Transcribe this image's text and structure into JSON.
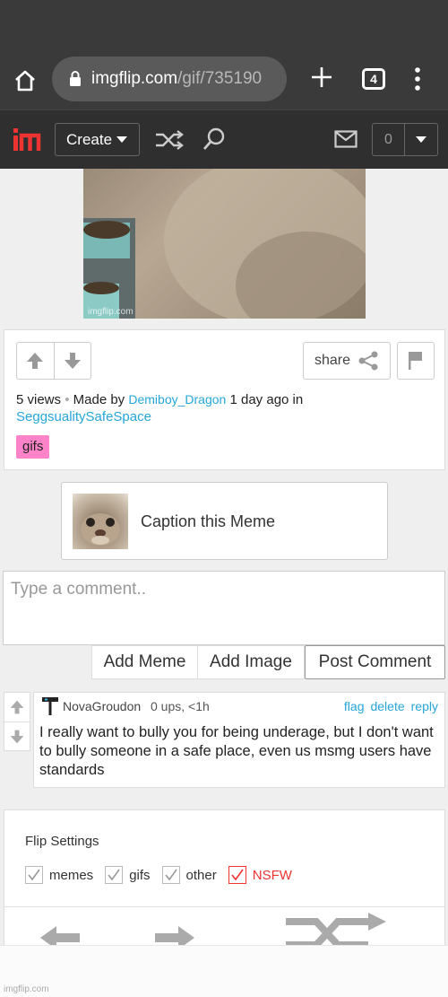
{
  "browser": {
    "url_domain": "imgflip.com",
    "url_path": "/gif/735190",
    "tab_count": "4"
  },
  "header": {
    "create_label": "Create",
    "notification_count": "0"
  },
  "gif": {
    "watermark": "imgflip.com"
  },
  "post": {
    "share_label": "share",
    "views": "5 views",
    "separator": "•",
    "made_by": "Made by",
    "creator": "Demiboy_Dragon",
    "time_text": "1 day ago in",
    "stream": "SeggsualitySafeSpace",
    "tag": "gifs"
  },
  "caption": {
    "label": "Caption this Meme"
  },
  "comment_box": {
    "placeholder": "Type a comment..",
    "add_meme": "Add Meme",
    "add_image": "Add Image",
    "post_comment": "Post Comment"
  },
  "comment": {
    "username": "NovaGroudon",
    "ups": "0 ups, <1h",
    "flag": "flag",
    "delete": "delete",
    "reply": "reply",
    "body": "I really want to bully you for being underage, but I don't want to bully someone in a safe place, even us msmg users have standards"
  },
  "flip_settings": {
    "title": "Flip Settings",
    "options": [
      "memes",
      "gifs",
      "other",
      "NSFW"
    ]
  },
  "bottom": {
    "brand": "imgflip.com"
  },
  "colors": {
    "link": "#26a6d8",
    "tag_bg": "#ff83c8",
    "nsfw": "#e33333",
    "header_bg": "#2f2f2f"
  }
}
